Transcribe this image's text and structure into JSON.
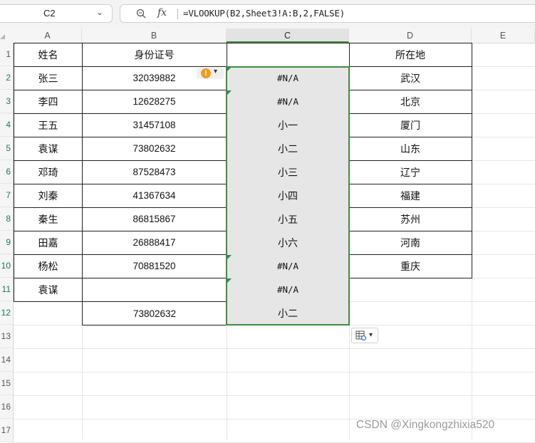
{
  "formula_bar": {
    "cell_ref": "C2",
    "fx_label": "fx",
    "formula": "=VLOOKUP(B2,Sheet3!A:B,2,FALSE)"
  },
  "columns": [
    "A",
    "B",
    "C",
    "D",
    "E"
  ],
  "rows": [
    "1",
    "2",
    "3",
    "4",
    "5",
    "6",
    "7",
    "8",
    "9",
    "10",
    "11",
    "12",
    "13",
    "14",
    "15",
    "16",
    "17"
  ],
  "table": {
    "headers": [
      "姓名",
      "身份证号",
      "",
      "所在地"
    ],
    "data": [
      [
        "张三",
        "32039882",
        "#N/A",
        "武汉"
      ],
      [
        "李四",
        "12628275",
        "#N/A",
        "北京"
      ],
      [
        "王五",
        "31457108",
        "小一",
        "厦门"
      ],
      [
        "袁谋",
        "73802632",
        "小二",
        "山东"
      ],
      [
        "邓琦",
        "87528473",
        "小三",
        "辽宁"
      ],
      [
        "刘秦",
        "41367634",
        "小四",
        "福建"
      ],
      [
        "秦生",
        "86815867",
        "小五",
        "苏州"
      ],
      [
        "田嘉",
        "26888417",
        "小六",
        "河南"
      ],
      [
        "杨松",
        "70881520",
        "#N/A",
        "重庆"
      ],
      [
        "袁谋",
        "",
        "#N/A",
        ""
      ],
      [
        "",
        "73802632",
        "小二",
        ""
      ]
    ]
  },
  "active_column": "C",
  "error_warning_icon": "exclamation-icon",
  "paste_options_icon": "paste-options-icon",
  "watermark": "CSDN @Xingkongzhixia520",
  "colors": {
    "selection_border": "#3d8f3d",
    "warning": "#f29b1d"
  }
}
